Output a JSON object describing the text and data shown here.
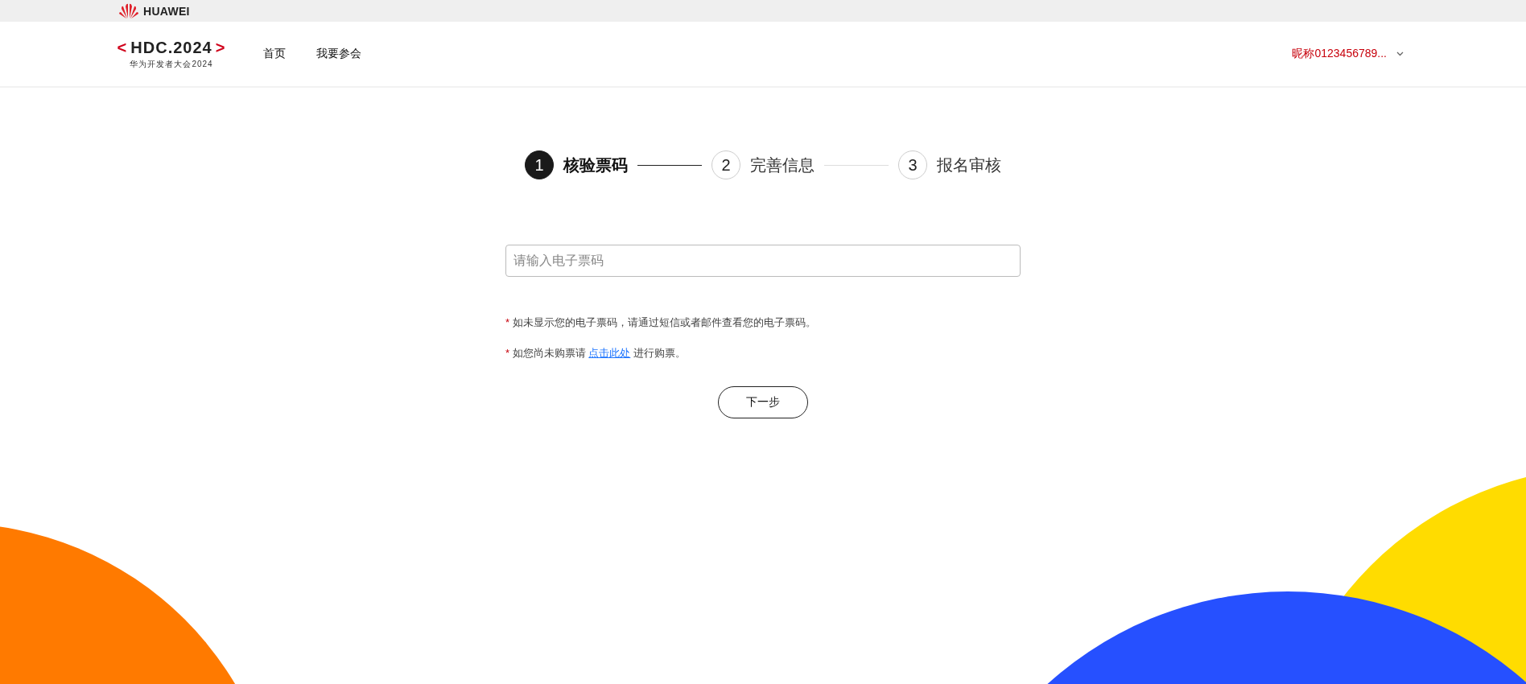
{
  "topbar": {
    "brand": "HUAWEI"
  },
  "header": {
    "logo": {
      "open": "<",
      "name": "HDC.2024",
      "close": ">",
      "subtitle": "华为开发者大会2024"
    },
    "nav": [
      {
        "label": "首页"
      },
      {
        "label": "我要参会"
      }
    ],
    "user": {
      "name": "昵称0123456789..."
    }
  },
  "steps": [
    {
      "number": "1",
      "label": "核验票码",
      "selected": true
    },
    {
      "number": "2",
      "label": "完善信息",
      "selected": false
    },
    {
      "number": "3",
      "label": "报名审核",
      "selected": false
    }
  ],
  "ticket_field": {
    "placeholder": "请输入电子票码"
  },
  "notes": [
    {
      "marker": "*",
      "text": "如未显示您的电子票码，请通过短信或者邮件查看您的电子票码。"
    },
    {
      "marker": "*",
      "text": "如您尚未购票请",
      "link": "点击此处",
      "after": "进行购票。"
    }
  ],
  "next_button": {
    "label": "下一步"
  }
}
